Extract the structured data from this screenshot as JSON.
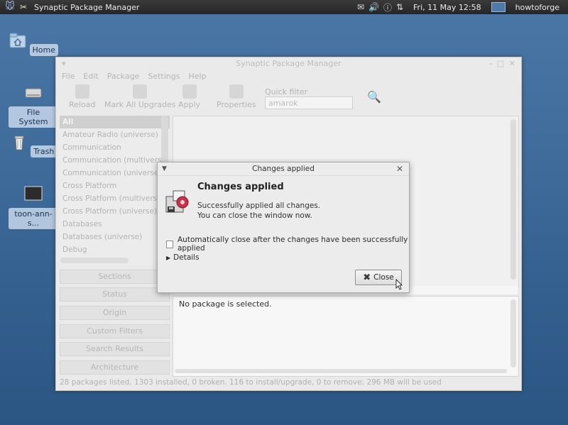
{
  "panel": {
    "app_title": "Synaptic Package Manager",
    "clock": "Fri, 11 May  12:58",
    "user": "howtoforge"
  },
  "desktop": {
    "icons": [
      {
        "label": "Home"
      },
      {
        "label": "File System"
      },
      {
        "label": "Trash"
      },
      {
        "label": "toon-ann-s..."
      }
    ]
  },
  "window": {
    "title": "Synaptic Package Manager",
    "menu": [
      "File",
      "Edit",
      "Package",
      "Settings",
      "Help"
    ],
    "toolbar": {
      "reload": "Reload",
      "mark_all": "Mark All Upgrades",
      "apply": "Apply",
      "properties": "Properties",
      "quick_filter_label": "Quick filter",
      "quick_filter_value": "amarok"
    },
    "categories": [
      "All",
      "Amateur Radio (universe)",
      "Communication",
      "Communication (multiverse)",
      "Communication (universe)",
      "Cross Platform",
      "Cross Platform (multiverse)",
      "Cross Platform (universe)",
      "Databases",
      "Databases (universe)",
      "Debug"
    ],
    "filter_buttons": [
      "Sections",
      "Status",
      "Origin",
      "Custom Filters",
      "Search Results",
      "Architecture"
    ],
    "description": "No package is selected.",
    "status": "28 packages listed, 1303 installed, 0 broken. 116 to install/upgrade, 0 to remove; 296 MB will be used"
  },
  "dialog": {
    "title": "Changes applied",
    "heading": "Changes applied",
    "message1": "Successfully applied all changes.",
    "message2": "You can close the window now.",
    "checkbox_label": "Automatically close after the changes have been successfully applied",
    "details": "Details",
    "close": "Close"
  }
}
